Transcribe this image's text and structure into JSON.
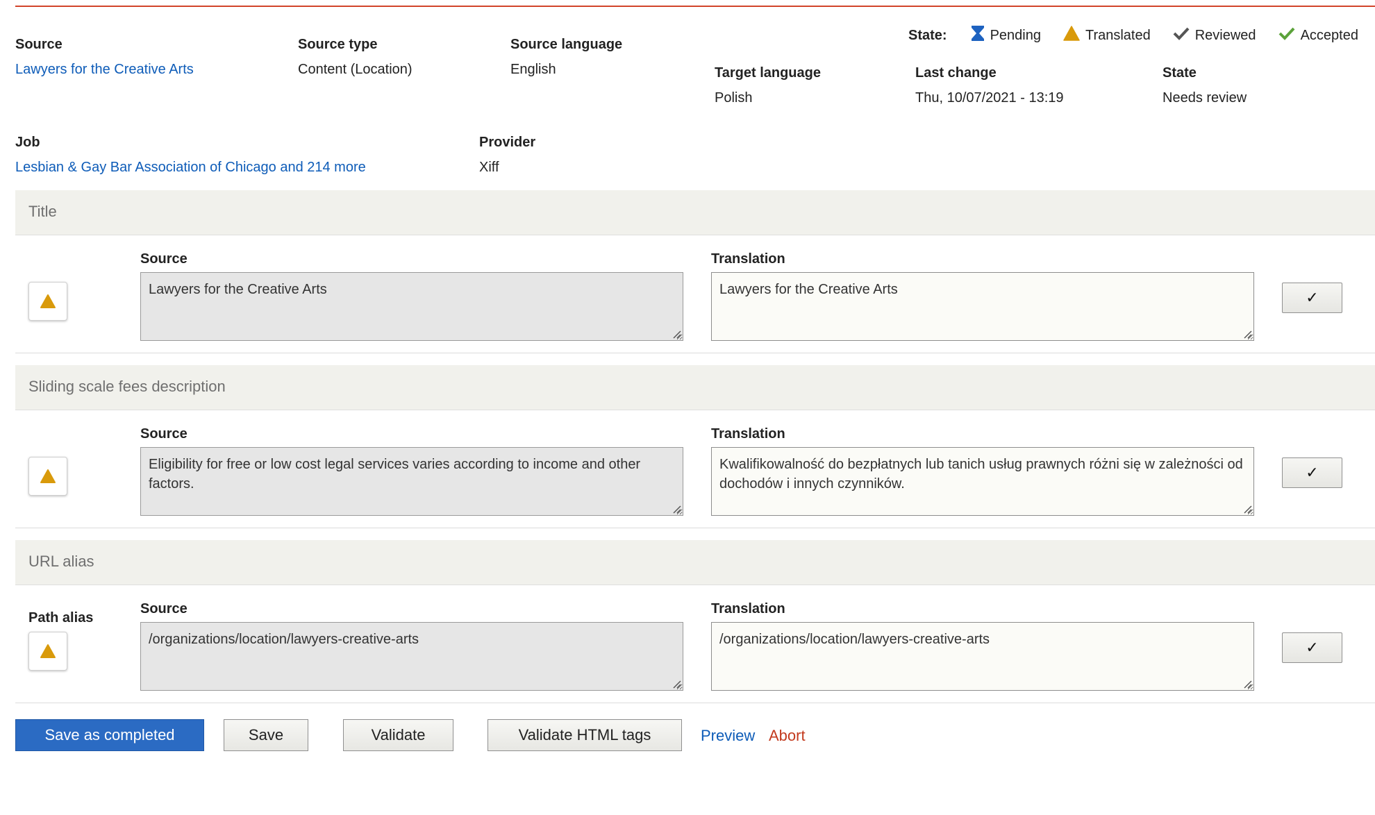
{
  "meta": {
    "source_label": "Source",
    "source_value": "Lawyers for the Creative Arts",
    "source_type_label": "Source type",
    "source_type_value": "Content (Location)",
    "source_language_label": "Source language",
    "source_language_value": "English",
    "target_language_label": "Target language",
    "target_language_value": "Polish",
    "last_change_label": "Last change",
    "last_change_value": "Thu, 10/07/2021 - 13:19",
    "state_label": "State",
    "state_value": "Needs review",
    "job_label": "Job",
    "job_value": "Lesbian & Gay Bar Association of Chicago and 214 more",
    "provider_label": "Provider",
    "provider_value": "Xiff"
  },
  "legend": {
    "title": "State:",
    "items": [
      {
        "label": "Pending",
        "icon": "hourglass-icon"
      },
      {
        "label": "Translated",
        "icon": "warning-triangle-icon"
      },
      {
        "label": "Reviewed",
        "icon": "checkmark-gray-icon"
      },
      {
        "label": "Accepted",
        "icon": "checkmark-green-icon"
      }
    ]
  },
  "sections": [
    {
      "title": "Title",
      "source_label": "Source",
      "translation_label": "Translation",
      "source_text": "Lawyers for the Creative Arts",
      "translation_text": "Lawyers for the Creative Arts",
      "review_button": "✓"
    },
    {
      "title": "Sliding scale fees description",
      "source_label": "Source",
      "translation_label": "Translation",
      "source_text": "Eligibility for free or low cost legal services varies according to income and other factors.",
      "translation_text": "Kwalifikowalność do bezpłatnych lub tanich usług prawnych różni się w zależności od dochodów i innych czynników.",
      "review_button": "✓"
    },
    {
      "title": "URL alias",
      "field_label": "Path alias",
      "source_label": "Source",
      "translation_label": "Translation",
      "source_text": "/organizations/location/lawyers-creative-arts",
      "translation_text": "/organizations/location/lawyers-creative-arts",
      "review_button": "✓"
    }
  ],
  "actions": {
    "save_completed": "Save as completed",
    "save": "Save",
    "validate": "Validate",
    "validate_html": "Validate HTML tags",
    "preview": "Preview",
    "abort": "Abort"
  },
  "colors": {
    "accent_red": "#d2432a",
    "link_blue": "#0e5cb8",
    "primary_blue": "#2b6bc3",
    "translated_orange": "#d99a0b",
    "pending_blue": "#1d62c0",
    "reviewed_gray": "#555555",
    "accepted_green": "#5ba23a",
    "abort_red": "#c33a1e"
  }
}
